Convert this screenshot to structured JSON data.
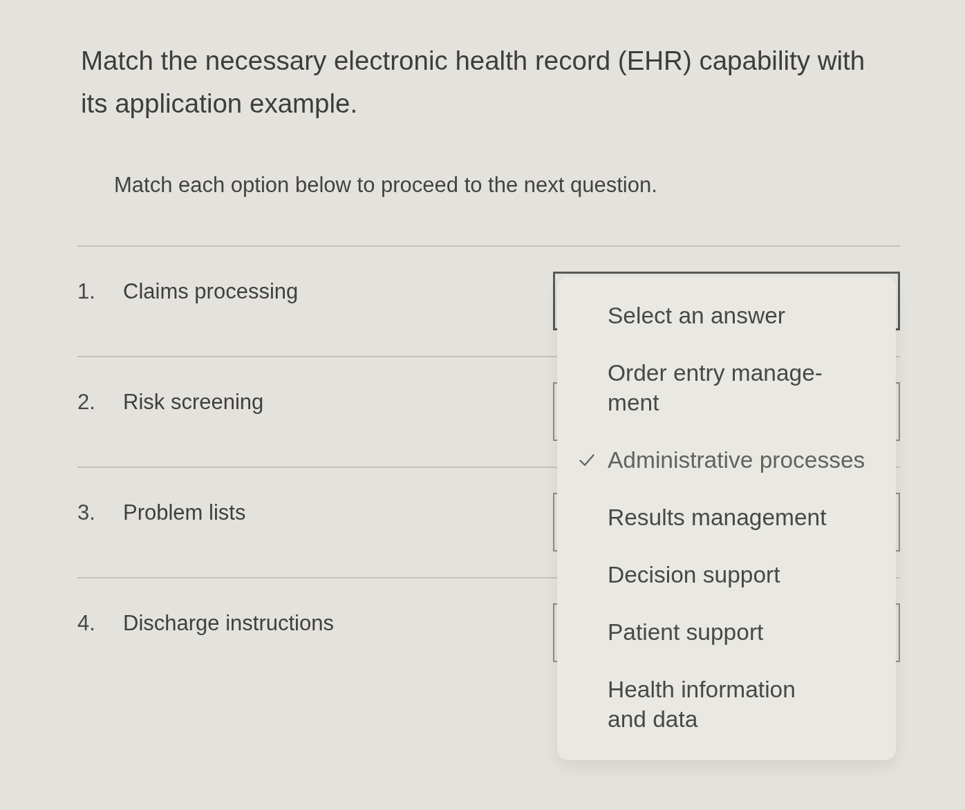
{
  "question": {
    "title": "Match the necessary electronic health record (EHR) capability with its application example.",
    "instruction": "Match each option below to proceed to the next question."
  },
  "items": [
    {
      "number": "1.",
      "label": "Claims processing",
      "select": {
        "focused": true
      }
    },
    {
      "number": "2.",
      "label": "Risk screening",
      "select": {
        "focused": false
      }
    },
    {
      "number": "3.",
      "label": "Problem lists",
      "select": {
        "focused": false
      }
    },
    {
      "number": "4.",
      "label": "Discharge instructions",
      "select": {
        "focused": false
      }
    }
  ],
  "dropdown": {
    "options": [
      {
        "label": "Select an answer",
        "selected": false
      },
      {
        "label": "Order entry manage-\nment",
        "selected": false
      },
      {
        "label": "Administrative processes",
        "selected": true
      },
      {
        "label": "Results management",
        "selected": false
      },
      {
        "label": "Decision support",
        "selected": false
      },
      {
        "label": "Patient support",
        "selected": false
      },
      {
        "label": "Health information\nand data",
        "selected": false
      }
    ]
  }
}
